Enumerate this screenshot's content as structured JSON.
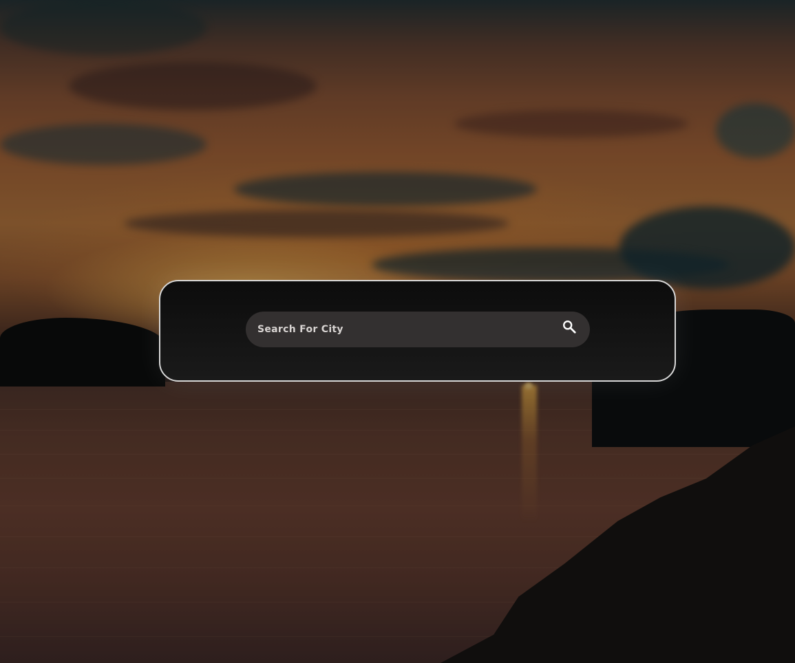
{
  "search": {
    "placeholder": "Search For City",
    "icon": "search-icon"
  },
  "colors": {
    "card_border": "#d8d8d8",
    "card_background": "#111111",
    "input_background": "#333030",
    "text": "#e6e2e0"
  }
}
